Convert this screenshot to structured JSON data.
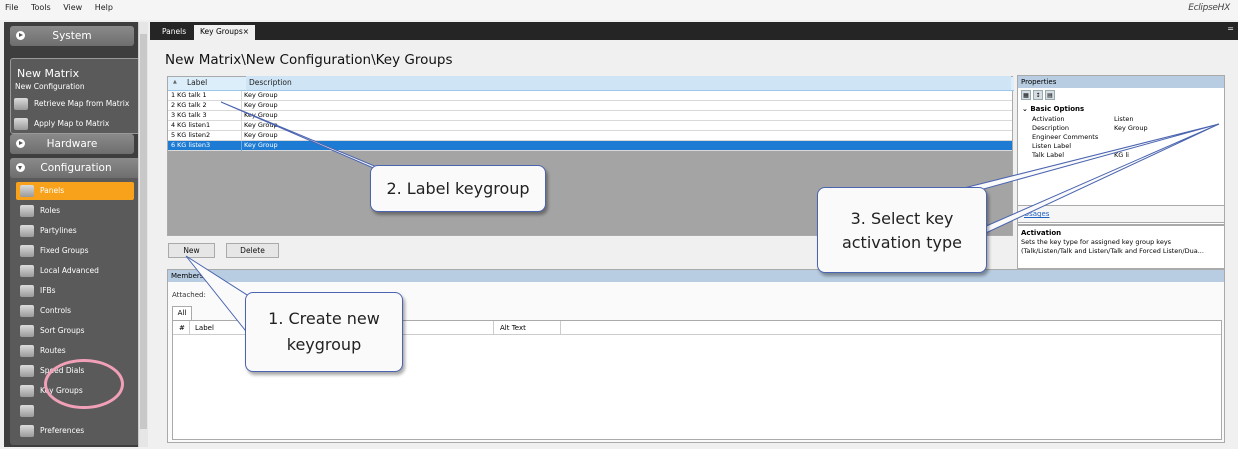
{
  "menu": [
    "File",
    "Tools",
    "View",
    "Help"
  ],
  "brand": "EclipseHX",
  "sidebar": {
    "system_label": "System",
    "matrix_title": "New Matrix",
    "config_name": "New Configuration",
    "actions": [
      "Retrieve Map from Matrix",
      "Apply Map to Matrix"
    ],
    "hardware_label": "Hardware",
    "configuration_label": "Configuration",
    "items": [
      "Panels",
      "Roles",
      "Partylines",
      "Fixed Groups",
      "Local Advanced",
      "IFBs",
      "Controls",
      "Sort Groups",
      "Routes",
      "Speed Dials",
      "Key Groups",
      "Panel",
      "Preferences"
    ],
    "active_item": "Panels"
  },
  "tabs": {
    "panels": "Panels",
    "key_groups": "Key Groups",
    "close": "×",
    "menu": "="
  },
  "breadcrumb": "New Matrix\\New Configuration\\Key Groups",
  "grid": {
    "sort_glyph": "▲",
    "col_label": "Label",
    "col_description": "Description",
    "rows": [
      {
        "num": "1",
        "label": "KG talk 1",
        "description": "Key Group"
      },
      {
        "num": "2",
        "label": "KG talk 2",
        "description": "Key Group"
      },
      {
        "num": "3",
        "label": "KG talk 3",
        "description": "Key Group"
      },
      {
        "num": "4",
        "label": "KG listen1",
        "description": "Key Group"
      },
      {
        "num": "5",
        "label": "KG listen2",
        "description": "Key Group"
      },
      {
        "num": "6",
        "label": "KG listen3",
        "description": "Key Group"
      }
    ],
    "selected_row": 6
  },
  "buttons": {
    "new": "New",
    "delete": "Delete"
  },
  "properties": {
    "title": "Properties",
    "section": "Basic Options",
    "rows": [
      {
        "key": "Activation",
        "value": "Listen"
      },
      {
        "key": "Description",
        "value": "Key Group"
      },
      {
        "key": "Engineer Comments",
        "value": ""
      },
      {
        "key": "Listen Label",
        "value": ""
      },
      {
        "key": "Talk Label",
        "value": "KG li"
      }
    ],
    "usages_link": "Usages",
    "desc_title": "Activation",
    "desc_text": "Sets the key type for assigned key group keys (Talk/Listen/Talk and Listen/Talk and Forced Listen/Dua..."
  },
  "members": {
    "title": "Members",
    "attached_label": "Attached:",
    "tab_all": "All",
    "col_num": "#",
    "col_label": "Label",
    "col_alt": "Alt Text"
  },
  "callouts": {
    "c1": "1. Create new keygroup",
    "c2": "2. Label keygroup",
    "c3": "3. Select key activation type"
  },
  "colors": {
    "accent_orange": "#f7a21a",
    "selection_blue": "#1e7bd4",
    "callout_border": "#4a64b0",
    "highlight_ring": "#f1a0b8"
  }
}
